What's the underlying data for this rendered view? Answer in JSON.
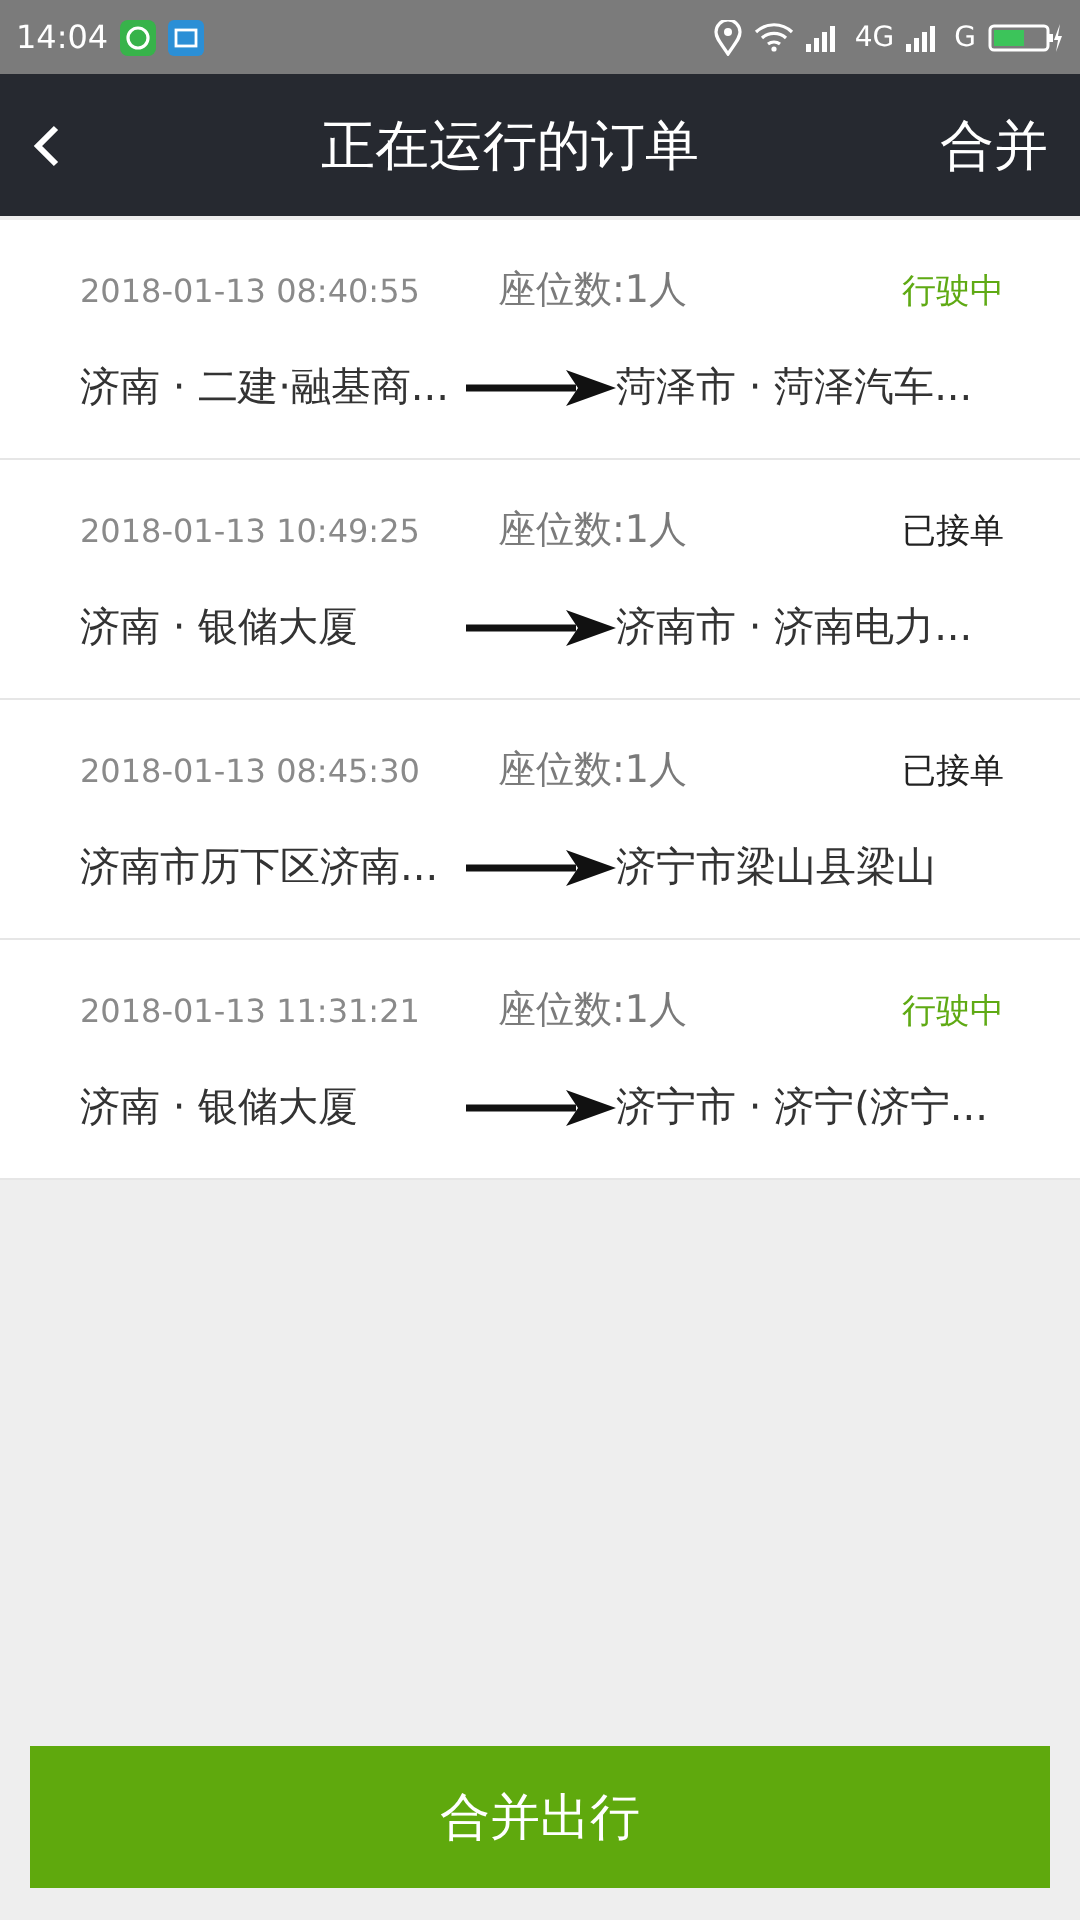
{
  "status_bar": {
    "time": "14:04",
    "network_1": "4G",
    "network_2": "G"
  },
  "header": {
    "title": "正在运行的订单",
    "action": "合并"
  },
  "orders": [
    {
      "datetime": "2018-01-13 08:40:55",
      "seats": "座位数:1人",
      "status": {
        "kind": "driving",
        "label": "行驶中"
      },
      "from": "济南 · 二建·融基商...",
      "to": "菏泽市 · 菏泽汽车..."
    },
    {
      "datetime": "2018-01-13 10:49:25",
      "seats": "座位数:1人",
      "status": {
        "kind": "accepted",
        "label": "已接单"
      },
      "from": "济南 · 银储大厦",
      "to": "济南市 · 济南电力..."
    },
    {
      "datetime": "2018-01-13 08:45:30",
      "seats": "座位数:1人",
      "status": {
        "kind": "accepted",
        "label": "已接单"
      },
      "from": "济南市历下区济南...",
      "to": "济宁市梁山县梁山"
    },
    {
      "datetime": "2018-01-13 11:31:21",
      "seats": "座位数:1人",
      "status": {
        "kind": "driving",
        "label": "行驶中"
      },
      "from": "济南 · 银储大厦",
      "to": "济宁市 · 济宁(济宁..."
    }
  ],
  "primary_button": "合并出行"
}
